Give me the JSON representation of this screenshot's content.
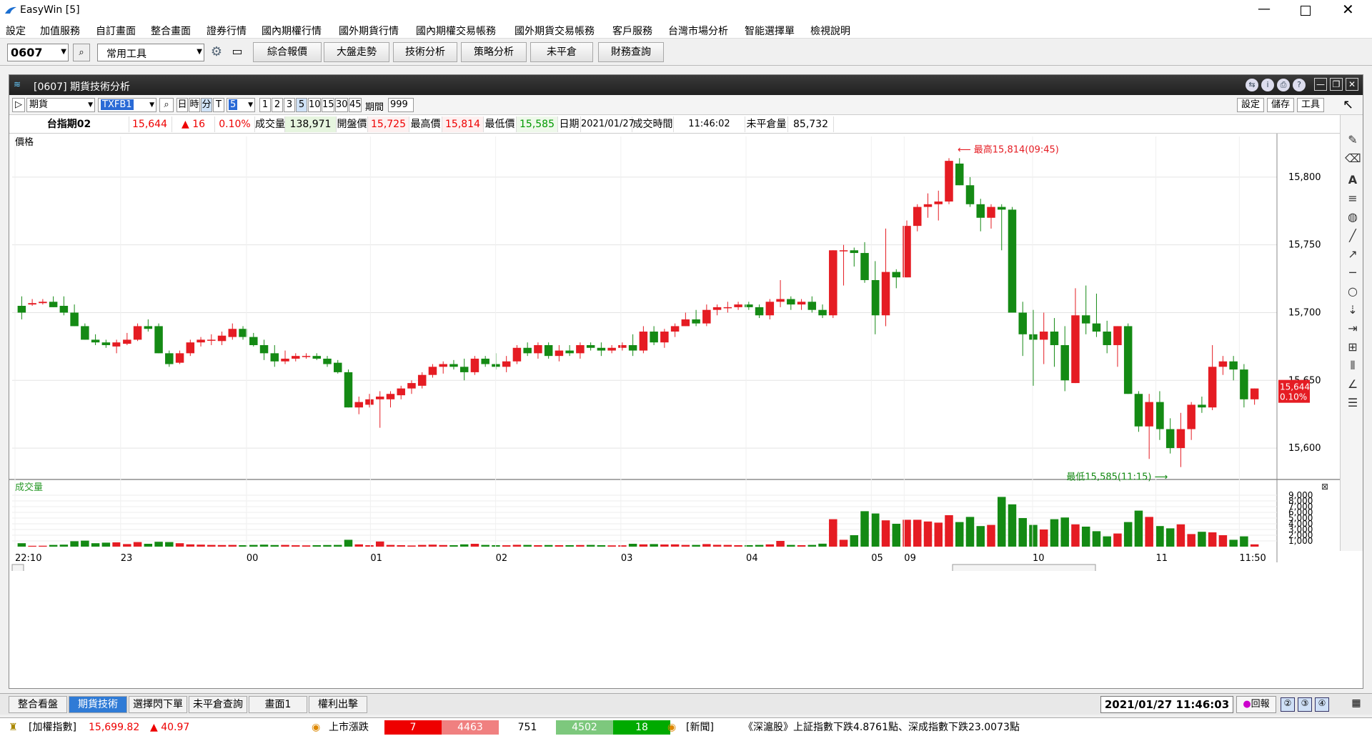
{
  "app": {
    "title": "EasyWin  [5]"
  },
  "menu": [
    "設定",
    "加值服務",
    "自訂畫面",
    "整合畫面",
    "證券行情",
    "國內期權行情",
    "國外期貨行情",
    "國內期權交易帳務",
    "國外期貨交易帳務",
    "客戶服務",
    "台灣市場分析",
    "智能選擇單",
    "檢視說明"
  ],
  "toolbar": {
    "code": "0607",
    "tool_select": "常用工具",
    "buttons": [
      "綜合報價",
      "大盤走勢",
      "技術分析",
      "策略分析",
      "未平倉",
      "財務查詢"
    ]
  },
  "window": {
    "title": "[0607] 期貨技術分析"
  },
  "controls": {
    "market": "期貨",
    "symbol": "TXFB1",
    "periods": [
      "日",
      "時",
      "分",
      "T"
    ],
    "minute_value": "5",
    "minute_options": [
      "1",
      "2",
      "3",
      "5",
      "10",
      "15",
      "30",
      "45"
    ],
    "range_label": "期間",
    "range_value": "999",
    "right_buttons": [
      "設定",
      "儲存",
      "工具"
    ]
  },
  "quote": {
    "name": "台指期02",
    "price": "15,644",
    "change": "▲ 16",
    "pct": "0.10%",
    "vol_label": "成交量",
    "vol": "138,971",
    "open_label": "開盤價",
    "open": "15,725",
    "high_label": "最高價",
    "high": "15,814",
    "low_label": "最低價",
    "low": "15,585",
    "date_label": "日期",
    "date": "2021/01/27",
    "time_label": "成交時間",
    "time": "11:46:02",
    "oi_label": "未平倉量",
    "oi": "85,732"
  },
  "chart_data": {
    "type": "candlestick",
    "price_panel_label": "價格",
    "volume_panel_label": "成交量",
    "y_ticks": [
      15600,
      15650,
      15700,
      15750,
      15800
    ],
    "y_tick_labels": [
      "15,600",
      "15,650",
      "15,700",
      "15,750",
      "15,800"
    ],
    "ylim": [
      15580,
      15830
    ],
    "vol_ticks": [
      "1,000",
      "2,000",
      "3,000",
      "4,000",
      "5,000",
      "6,000",
      "7,000",
      "8,000",
      "9,000"
    ],
    "vol_max": 9000,
    "x_labels": [
      "22:10",
      "23",
      "00",
      "01",
      "02",
      "03",
      "04",
      "05",
      "09",
      "10",
      "11",
      "11:50"
    ],
    "last_price_tag": "15,644",
    "last_pct_tag": "0.10%",
    "annotation_high": "最高15,814(09:45)",
    "annotation_low": "最低15,585(11:15)",
    "candles": [
      [
        15705,
        15712,
        15695,
        15700,
        600
      ],
      [
        15706,
        15710,
        15705,
        15707,
        150
      ],
      [
        15707,
        15710,
        15706,
        15708,
        160
      ],
      [
        15708,
        15712,
        15704,
        15704,
        300
      ],
      [
        15705,
        15712,
        15698,
        15700,
        350
      ],
      [
        15700,
        15706,
        15690,
        15690,
        950
      ],
      [
        15690,
        15692,
        15680,
        15680,
        1050
      ],
      [
        15680,
        15684,
        15676,
        15678,
        600
      ],
      [
        15678,
        15680,
        15674,
        15676,
        700
      ],
      [
        15675,
        15680,
        15670,
        15678,
        750
      ],
      [
        15677,
        15685,
        15676,
        15680,
        450
      ],
      [
        15680,
        15692,
        15679,
        15690,
        800
      ],
      [
        15690,
        15695,
        15686,
        15688,
        500
      ],
      [
        15690,
        15692,
        15670,
        15670,
        850
      ],
      [
        15670,
        15672,
        15660,
        15662,
        800
      ],
      [
        15663,
        15672,
        15662,
        15670,
        600
      ],
      [
        15670,
        15680,
        15668,
        15678,
        400
      ],
      [
        15678,
        15682,
        15675,
        15680,
        350
      ],
      [
        15680,
        15684,
        15676,
        15680,
        300
      ],
      [
        15679,
        15686,
        15676,
        15683,
        280
      ],
      [
        15682,
        15692,
        15680,
        15688,
        300
      ],
      [
        15688,
        15690,
        15680,
        15682,
        250
      ],
      [
        15682,
        15685,
        15675,
        15676,
        300
      ],
      [
        15676,
        15680,
        15665,
        15670,
        350
      ],
      [
        15670,
        15676,
        15660,
        15664,
        280
      ],
      [
        15664,
        15672,
        15662,
        15666,
        300
      ],
      [
        15666,
        15670,
        15664,
        15668,
        240
      ],
      [
        15668,
        15670,
        15666,
        15668,
        220
      ],
      [
        15668,
        15670,
        15665,
        15666,
        250
      ],
      [
        15666,
        15668,
        15660,
        15662,
        280
      ],
      [
        15663,
        15665,
        15655,
        15656,
        300
      ],
      [
        15656,
        15658,
        15630,
        15630,
        1200
      ],
      [
        15630,
        15638,
        15625,
        15634,
        400
      ],
      [
        15632,
        15640,
        15630,
        15636,
        250
      ],
      [
        15636,
        15642,
        15615,
        15638,
        900
      ],
      [
        15636,
        15642,
        15630,
        15640,
        300
      ],
      [
        15639,
        15646,
        15636,
        15644,
        250
      ],
      [
        15644,
        15650,
        15640,
        15648,
        200
      ],
      [
        15646,
        15656,
        15644,
        15654,
        300
      ],
      [
        15654,
        15662,
        15652,
        15660,
        350
      ],
      [
        15660,
        15664,
        15655,
        15662,
        280
      ],
      [
        15662,
        15665,
        15658,
        15660,
        250
      ],
      [
        15660,
        15666,
        15650,
        15656,
        400
      ],
      [
        15656,
        15668,
        15654,
        15666,
        500
      ],
      [
        15666,
        15668,
        15660,
        15662,
        300
      ],
      [
        15662,
        15670,
        15658,
        15660,
        250
      ],
      [
        15660,
        15668,
        15656,
        15664,
        240
      ],
      [
        15664,
        15676,
        15662,
        15674,
        320
      ],
      [
        15674,
        15678,
        15668,
        15670,
        300
      ],
      [
        15670,
        15678,
        15666,
        15676,
        250
      ],
      [
        15676,
        15678,
        15666,
        15668,
        280
      ],
      [
        15668,
        15676,
        15664,
        15672,
        250
      ],
      [
        15672,
        15676,
        15668,
        15670,
        260
      ],
      [
        15670,
        15678,
        15666,
        15676,
        280
      ],
      [
        15676,
        15678,
        15672,
        15674,
        300
      ],
      [
        15674,
        15678,
        15668,
        15672,
        250
      ],
      [
        15672,
        15676,
        15670,
        15674,
        220
      ],
      [
        15674,
        15678,
        15672,
        15676,
        230
      ],
      [
        15676,
        15684,
        15668,
        15672,
        500
      ],
      [
        15672,
        15690,
        15670,
        15686,
        400
      ],
      [
        15686,
        15690,
        15676,
        15678,
        450
      ],
      [
        15678,
        15688,
        15674,
        15686,
        380
      ],
      [
        15686,
        15692,
        15682,
        15690,
        400
      ],
      [
        15690,
        15700,
        15690,
        15695,
        300
      ],
      [
        15695,
        15702,
        15690,
        15692,
        300
      ],
      [
        15692,
        15706,
        15690,
        15702,
        450
      ],
      [
        15702,
        15706,
        15698,
        15704,
        320
      ],
      [
        15704,
        15708,
        15700,
        15704,
        300
      ],
      [
        15704,
        15708,
        15702,
        15706,
        250
      ],
      [
        15706,
        15708,
        15702,
        15704,
        260
      ],
      [
        15704,
        15706,
        15696,
        15698,
        300
      ],
      [
        15698,
        15710,
        15695,
        15708,
        400
      ],
      [
        15708,
        15724,
        15704,
        15710,
        1000
      ],
      [
        15710,
        15712,
        15702,
        15706,
        300
      ],
      [
        15706,
        15710,
        15702,
        15708,
        250
      ],
      [
        15708,
        15712,
        15700,
        15702,
        300
      ],
      [
        15702,
        15706,
        15696,
        15698,
        520
      ],
      [
        15698,
        15746,
        15696,
        15746,
        4800
      ],
      [
        15746,
        15750,
        15720,
        15746,
        1200
      ],
      [
        15746,
        15748,
        15734,
        15744,
        2000
      ],
      [
        15744,
        15752,
        15722,
        15724,
        6200
      ],
      [
        15724,
        15738,
        15684,
        15698,
        5800
      ],
      [
        15698,
        15762,
        15690,
        15730,
        4600
      ],
      [
        15730,
        15732,
        15718,
        15726,
        4000
      ],
      [
        15726,
        15768,
        15726,
        15764,
        4700
      ],
      [
        15764,
        15780,
        15760,
        15778,
        4700
      ],
      [
        15778,
        15788,
        15770,
        15780,
        4400
      ],
      [
        15780,
        15790,
        15768,
        15782,
        4200
      ],
      [
        15782,
        15814,
        15780,
        15812,
        5500
      ],
      [
        15810,
        15814,
        15794,
        15794,
        4300
      ],
      [
        15794,
        15800,
        15778,
        15780,
        5200
      ],
      [
        15780,
        15784,
        15760,
        15770,
        3600
      ],
      [
        15770,
        15780,
        15762,
        15778,
        3800
      ],
      [
        15778,
        15780,
        15746,
        15776,
        8700
      ],
      [
        15776,
        15778,
        15700,
        15700,
        7400
      ],
      [
        15700,
        15708,
        15668,
        15684,
        5000
      ],
      [
        15684,
        15702,
        15646,
        15680,
        3800
      ],
      [
        15680,
        15700,
        15662,
        15686,
        3000
      ],
      [
        15686,
        15696,
        15660,
        15676,
        4800
      ],
      [
        15676,
        15690,
        15642,
        15650,
        5100
      ],
      [
        15648,
        15718,
        15648,
        15698,
        3900
      ],
      [
        15698,
        15720,
        15684,
        15692,
        3500
      ],
      [
        15692,
        15714,
        15682,
        15686,
        2700
      ],
      [
        15686,
        15694,
        15670,
        15676,
        1800
      ],
      [
        15676,
        15690,
        15660,
        15690,
        2300
      ],
      [
        15690,
        15692,
        15640,
        15640,
        4300
      ],
      [
        15640,
        15642,
        15612,
        15616,
        6300
      ],
      [
        15616,
        15640,
        15592,
        15634,
        5200
      ],
      [
        15634,
        15642,
        15606,
        15614,
        3600
      ],
      [
        15614,
        15622,
        15596,
        15600,
        3200
      ],
      [
        15600,
        15626,
        15586,
        15614,
        3900
      ],
      [
        15614,
        15634,
        15606,
        15632,
        2200
      ],
      [
        15632,
        15638,
        15626,
        15630,
        2600
      ],
      [
        15630,
        15676,
        15628,
        15660,
        2500
      ],
      [
        15660,
        15668,
        15654,
        15664,
        2000
      ],
      [
        15664,
        15668,
        15650,
        15658,
        1200
      ],
      [
        15658,
        15662,
        15630,
        15636,
        1800
      ],
      [
        15636,
        15644,
        15632,
        15644,
        400
      ]
    ]
  },
  "tabs": [
    "整合看盤",
    "期貨技術",
    "選擇閃下單",
    "未平倉查詢",
    "畫面1",
    "權利出擊"
  ],
  "clock": "2021/01/27 11:46:03",
  "reply_label": "回報",
  "status": {
    "index_label": "[加權指數]",
    "index_value": "15,699.82",
    "index_change": "▲ 40.97",
    "breadth_label": "上市漲跌",
    "breadth": [
      "7",
      "4463",
      "751",
      "4502",
      "18"
    ],
    "news_label": "[新聞]",
    "news_text": "《深滬股》上証指數下跌4.8761點、深成指數下跌23.0073點"
  }
}
